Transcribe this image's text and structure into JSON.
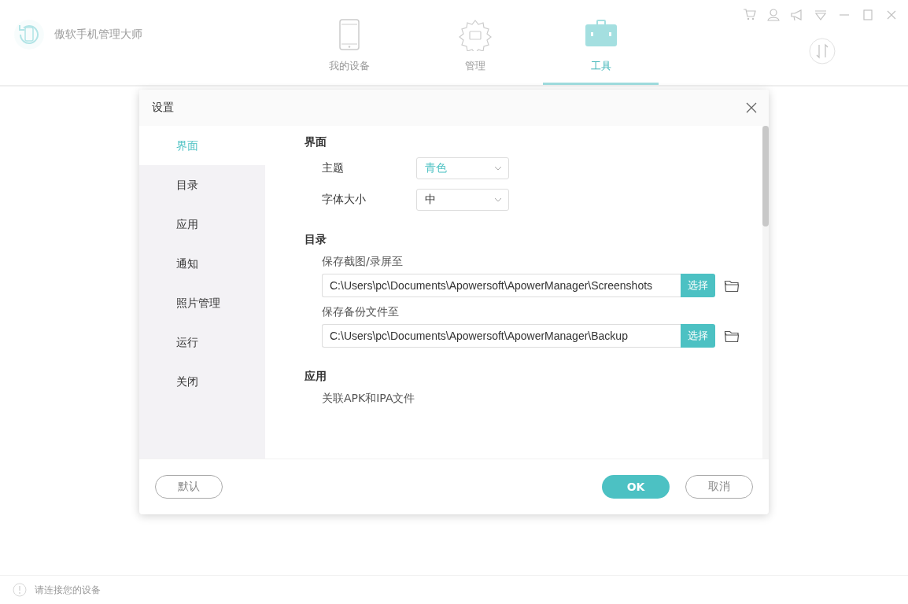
{
  "app": {
    "title": "傲软手机管理大师",
    "nav_tabs": [
      {
        "label": "我的设备",
        "selected": false
      },
      {
        "label": "管理",
        "selected": false
      },
      {
        "label": "工具",
        "selected": true
      }
    ],
    "status_bar": {
      "text": "请连接您的设备"
    }
  },
  "dialog": {
    "title": "设置",
    "sidebar": [
      {
        "label": "界面",
        "selected": true
      },
      {
        "label": "目录",
        "selected": false
      },
      {
        "label": "应用",
        "selected": false
      },
      {
        "label": "通知",
        "selected": false
      },
      {
        "label": "照片管理",
        "selected": false
      },
      {
        "label": "运行",
        "selected": false
      },
      {
        "label": "关闭",
        "selected": false
      }
    ],
    "sections": [
      {
        "heading": "界面",
        "rows": [
          {
            "kind": "select",
            "label": "主题",
            "value": "青色",
            "highlighted": true
          },
          {
            "kind": "select",
            "label": "字体大小",
            "value": "中",
            "highlighted": false
          }
        ]
      },
      {
        "heading": "目录",
        "rows": [
          {
            "kind": "path",
            "label": "保存截图/录屏至",
            "value": "C:\\Users\\pc\\Documents\\Apowersoft\\ApowerManager\\Screenshots",
            "button": "选择"
          },
          {
            "kind": "path",
            "label": "保存备份文件至",
            "value": "C:\\Users\\pc\\Documents\\Apowersoft\\ApowerManager\\Backup",
            "button": "选择"
          }
        ]
      },
      {
        "heading": "应用",
        "rows": [
          {
            "kind": "text",
            "label": "关联APK和IPA文件"
          }
        ]
      }
    ],
    "buttons": [
      {
        "label": "默认",
        "kind": "outline"
      },
      {
        "label": "OK",
        "kind": "primary"
      },
      {
        "label": "取消",
        "kind": "outline"
      }
    ]
  }
}
